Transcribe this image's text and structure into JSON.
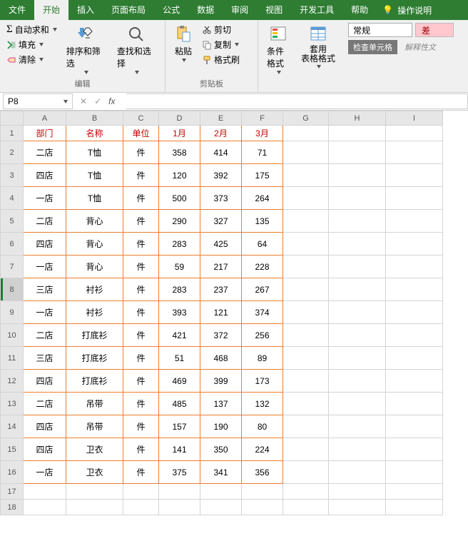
{
  "menubar": {
    "tabs": [
      "文件",
      "开始",
      "插入",
      "页面布局",
      "公式",
      "数据",
      "审阅",
      "视图",
      "开发工具",
      "帮助"
    ],
    "active": 1,
    "help_hint": "操作说明"
  },
  "ribbon": {
    "edit": {
      "autosum": "自动求和",
      "fill": "填充",
      "clear": "清除",
      "sortfilter": "排序和筛选",
      "findselect": "查找和选择",
      "group": "编辑"
    },
    "clipboard": {
      "paste": "粘贴",
      "cut": "剪切",
      "copy": "复制",
      "formatpainter": "格式刷",
      "group": "剪贴板"
    },
    "styles": {
      "condfmt": "条件格式",
      "tablefmt": "套用\n表格格式",
      "number_format": "常规",
      "check_cell": "检查单元格",
      "bad": "差",
      "explain": "解释性文"
    }
  },
  "namebox": "P8",
  "sheet": {
    "cols": [
      "A",
      "B",
      "C",
      "D",
      "E",
      "F",
      "G",
      "H",
      "I"
    ],
    "header": [
      "部门",
      "名称",
      "单位",
      "1月",
      "2月",
      "3月"
    ],
    "rows": [
      [
        "二店",
        "T恤",
        "件",
        "358",
        "414",
        "71"
      ],
      [
        "四店",
        "T恤",
        "件",
        "120",
        "392",
        "175"
      ],
      [
        "一店",
        "T恤",
        "件",
        "500",
        "373",
        "264"
      ],
      [
        "二店",
        "背心",
        "件",
        "290",
        "327",
        "135"
      ],
      [
        "四店",
        "背心",
        "件",
        "283",
        "425",
        "64"
      ],
      [
        "一店",
        "背心",
        "件",
        "59",
        "217",
        "228"
      ],
      [
        "三店",
        "衬衫",
        "件",
        "283",
        "237",
        "267"
      ],
      [
        "一店",
        "衬衫",
        "件",
        "393",
        "121",
        "374"
      ],
      [
        "二店",
        "打底衫",
        "件",
        "421",
        "372",
        "256"
      ],
      [
        "三店",
        "打底衫",
        "件",
        "51",
        "468",
        "89"
      ],
      [
        "四店",
        "打底衫",
        "件",
        "469",
        "399",
        "173"
      ],
      [
        "二店",
        "吊带",
        "件",
        "485",
        "137",
        "132"
      ],
      [
        "四店",
        "吊带",
        "件",
        "157",
        "190",
        "80"
      ],
      [
        "四店",
        "卫衣",
        "件",
        "141",
        "350",
        "224"
      ],
      [
        "一店",
        "卫衣",
        "件",
        "375",
        "341",
        "356"
      ]
    ],
    "active_row": 8
  }
}
